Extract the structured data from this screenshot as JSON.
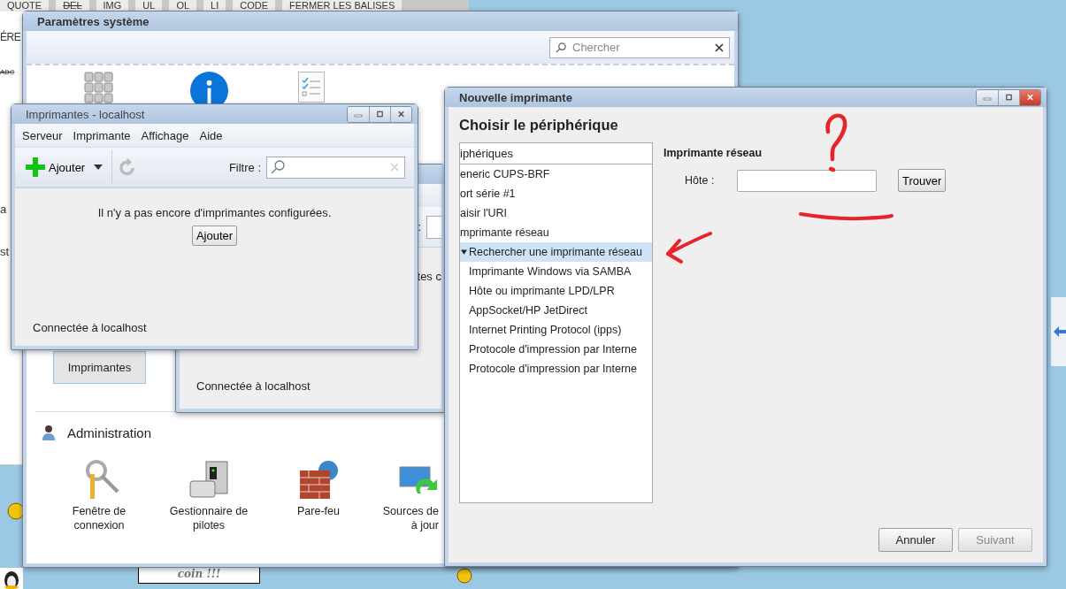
{
  "browser_page": {
    "toolbar_buttons": [
      {
        "label": "QUOTE",
        "struck": false
      },
      {
        "label": "DEL",
        "struck": true
      },
      {
        "label": "IMG",
        "struck": false
      },
      {
        "label": "UL",
        "struck": false
      },
      {
        "label": "OL",
        "struck": false
      },
      {
        "label": "LI",
        "struck": false
      },
      {
        "label": "CODE",
        "struck": false
      },
      {
        "label": "FERMER LES BALISES",
        "struck": false
      }
    ],
    "fragments": [
      {
        "text": "ÉRE",
        "struck": false
      },
      {
        "text": "ABC",
        "struck": true
      },
      {
        "text": "a",
        "struck": false
      },
      {
        "text": "st",
        "struck": false
      }
    ]
  },
  "system_settings": {
    "title": "Paramètres système",
    "search": {
      "placeholder": "Chercher"
    },
    "tile": {
      "label": "Imprimantes",
      "selected": true
    },
    "section": {
      "title": "Administration",
      "items": [
        {
          "kind": "key",
          "lines": [
            "Fenêtre de",
            "connexion"
          ],
          "cut": false
        },
        {
          "kind": "driver",
          "lines": [
            "Gestionnaire de",
            "pilotes"
          ],
          "cut": false
        },
        {
          "kind": "firewall",
          "lines": [
            "Pare-feu"
          ],
          "cut": false
        },
        {
          "kind": "sources",
          "lines": [
            "Sources de",
            "à jour"
          ],
          "cut": true
        }
      ]
    }
  },
  "printers_back": {
    "filter_label": ":",
    "message_fragment": "tes c",
    "status": "Connectée à localhost"
  },
  "printers": {
    "title": "Imprimantes - localhost",
    "menu": [
      "Serveur",
      "Imprimante",
      "Affichage",
      "Aide"
    ],
    "add_button": "Ajouter",
    "refresh_disabled": true,
    "filter_label": "Filtre :",
    "message": "Il n'y a pas encore d'imprimantes configurées.",
    "message_button": "Ajouter",
    "status": "Connectée à localhost"
  },
  "new_printer": {
    "title": "Nouvelle imprimante",
    "heading": "Choisir le périphérique",
    "list_header": "iphériques",
    "devices": [
      {
        "label": "eneric CUPS-BRF",
        "selected": false,
        "expanded": false
      },
      {
        "label": "ort série #1",
        "selected": false,
        "expanded": false
      },
      {
        "label": "aisir l'URI",
        "selected": false,
        "expanded": false
      },
      {
        "label": "mprimante réseau",
        "selected": false,
        "expanded": false,
        "children": [
          {
            "label": "Rechercher une imprimante réseau",
            "selected": true,
            "expanded": true
          },
          {
            "label": "Imprimante Windows via SAMBA",
            "selected": false,
            "expanded": false
          },
          {
            "label": "Hôte ou imprimante LPD/LPR",
            "selected": false,
            "expanded": false
          },
          {
            "label": "AppSocket/HP JetDirect",
            "selected": false,
            "expanded": false
          },
          {
            "label": "Internet Printing Protocol (ipps)",
            "selected": false,
            "expanded": false
          },
          {
            "label": "Protocole d'impression par Interne",
            "selected": false,
            "expanded": false
          },
          {
            "label": "Protocole d'impression par Interne",
            "selected": false,
            "expanded": false
          }
        ]
      }
    ],
    "panel_title": "Imprimante réseau",
    "host_label": "Hôte :",
    "find_button": "Trouver",
    "buttons": [
      {
        "label": "Annuler",
        "disabled": false
      },
      {
        "label": "Suivant",
        "disabled": true
      }
    ]
  },
  "desktop": {
    "sign_text": "coin !!!"
  }
}
